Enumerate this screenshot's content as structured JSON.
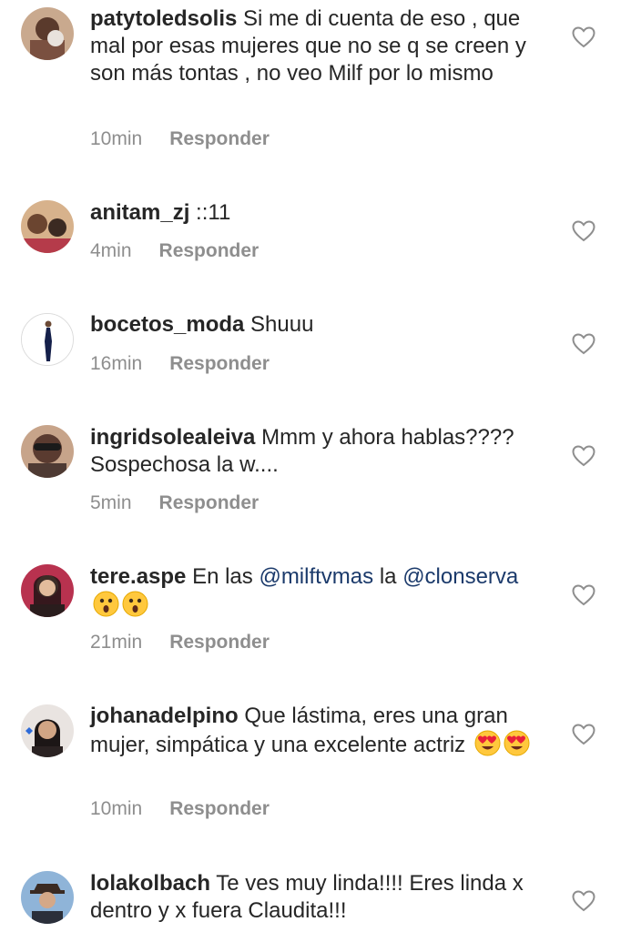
{
  "colors": {
    "text": "#262626",
    "meta": "#8e8e8e",
    "mention": "#1b3a6b"
  },
  "reply_label": "Responder",
  "comments": [
    {
      "username": "patytoledsolis",
      "text": "Si me di cuenta de eso , que mal por esas mujeres que no se q se creen y son más tontas , no veo Milf por lo mismo",
      "time": "10min"
    },
    {
      "username": "anitam_zj",
      "text": "::11",
      "time": "4min"
    },
    {
      "username": "bocetos_moda",
      "text": "Shuuu",
      "time": "16min"
    },
    {
      "username": "ingridsoleal eiva",
      "text": "Mmm y ahora hablas???? Sospechosa la w....",
      "time": "5min"
    },
    {
      "username": "tere.aspe",
      "text_pre": "En las",
      "mention1": "@milftvmas",
      "text_mid": "la",
      "mention2": "@clonserva",
      "emoji": "astonished-face-emoji",
      "time": "21min"
    },
    {
      "username": "johanadelpino",
      "text": "Que lástima,  eres una gran mujer, simpática y una excelente actriz",
      "emoji": "heart-eyes-emoji",
      "time": "10min"
    },
    {
      "username": "lolakolbach",
      "text": "Te ves muy linda!!!! Eres linda x dentro y x fuera Claudita!!!"
    }
  ]
}
